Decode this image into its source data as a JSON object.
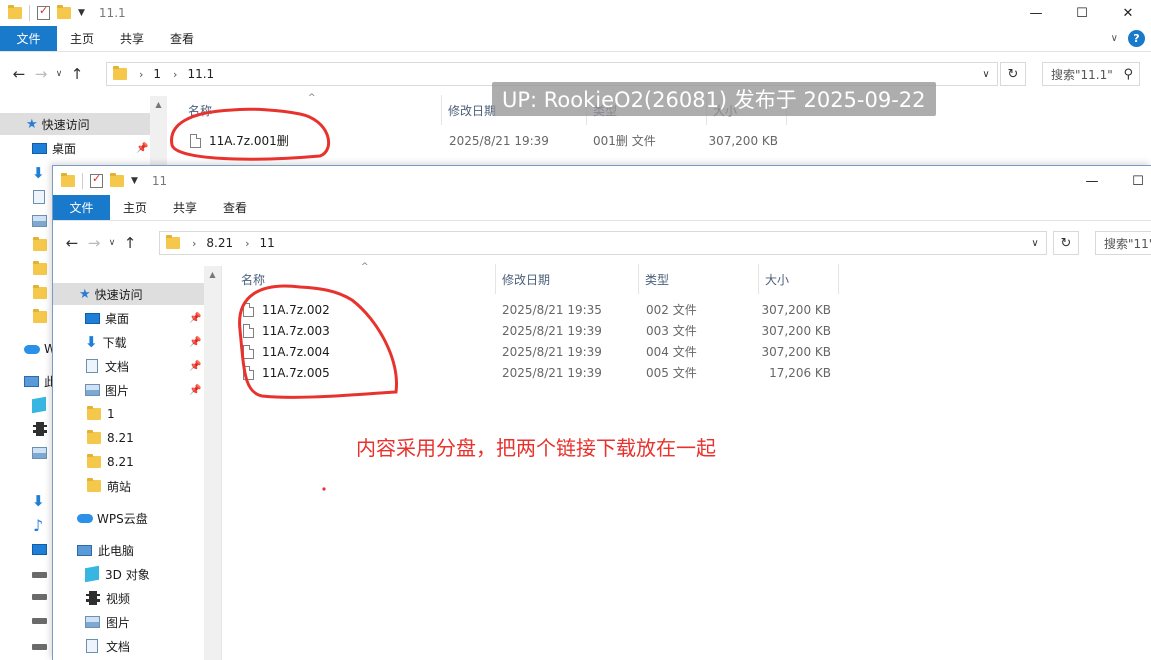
{
  "back_window": {
    "title": "11.1",
    "tabs": [
      "文件",
      "主页",
      "共享",
      "查看"
    ],
    "breadcrumb": [
      "1",
      "11.1"
    ],
    "search_placeholder": "搜索\"11.1\"",
    "sidebar": {
      "quick_access": "快速访问",
      "items": [
        "桌面"
      ]
    },
    "columns": [
      "名称",
      "修改日期",
      "类型",
      "大小"
    ],
    "files": [
      {
        "name": "11A.7z.001删",
        "date": "2025/8/21 19:39",
        "type": "001删 文件",
        "size": "307,200 KB"
      }
    ]
  },
  "front_window": {
    "title": "11",
    "tabs": [
      "文件",
      "主页",
      "共享",
      "查看"
    ],
    "breadcrumb": [
      "8.21",
      "11"
    ],
    "search_placeholder": "搜索\"11\"",
    "sidebar": {
      "quick_access": "快速访问",
      "items": [
        {
          "label": "桌面",
          "icon": "desktop-icon",
          "pinned": true
        },
        {
          "label": "下载",
          "icon": "download-icon",
          "pinned": true
        },
        {
          "label": "文档",
          "icon": "document-icon",
          "pinned": true
        },
        {
          "label": "图片",
          "icon": "picture-icon",
          "pinned": true
        },
        {
          "label": "1",
          "icon": "folder-icon",
          "pinned": false
        },
        {
          "label": "8.21",
          "icon": "folder-icon",
          "pinned": false
        },
        {
          "label": "8.21",
          "icon": "folder-icon",
          "pinned": false
        },
        {
          "label": "萌站",
          "icon": "folder-icon",
          "pinned": false
        }
      ],
      "wps_cloud": "WPS云盘",
      "this_pc": "此电脑",
      "pc_items": [
        {
          "label": "3D 对象",
          "icon": "3d-objects-icon"
        },
        {
          "label": "视频",
          "icon": "video-icon"
        },
        {
          "label": "图片",
          "icon": "picture-icon"
        },
        {
          "label": "文档",
          "icon": "document-icon"
        }
      ]
    },
    "columns": [
      "名称",
      "修改日期",
      "类型",
      "大小"
    ],
    "files": [
      {
        "name": "11A.7z.002",
        "date": "2025/8/21 19:35",
        "type": "002 文件",
        "size": "307,200 KB"
      },
      {
        "name": "11A.7z.003",
        "date": "2025/8/21 19:39",
        "type": "003 文件",
        "size": "307,200 KB"
      },
      {
        "name": "11A.7z.004",
        "date": "2025/8/21 19:39",
        "type": "004 文件",
        "size": "307,200 KB"
      },
      {
        "name": "11A.7z.005",
        "date": "2025/8/21 19:39",
        "type": "005 文件",
        "size": "17,206 KB"
      }
    ]
  },
  "back_sidebar_partial": {
    "wps_initial": "W",
    "pc_initial": "此"
  },
  "watermark": "UP: RookieO2(26081) 发布于 2025-09-22",
  "annotation": "内容采用分盘，把两个链接下载放在一起",
  "colors": {
    "accent": "#1979ca",
    "annotation_red": "#e8322d",
    "folder": "#f5c84c"
  }
}
